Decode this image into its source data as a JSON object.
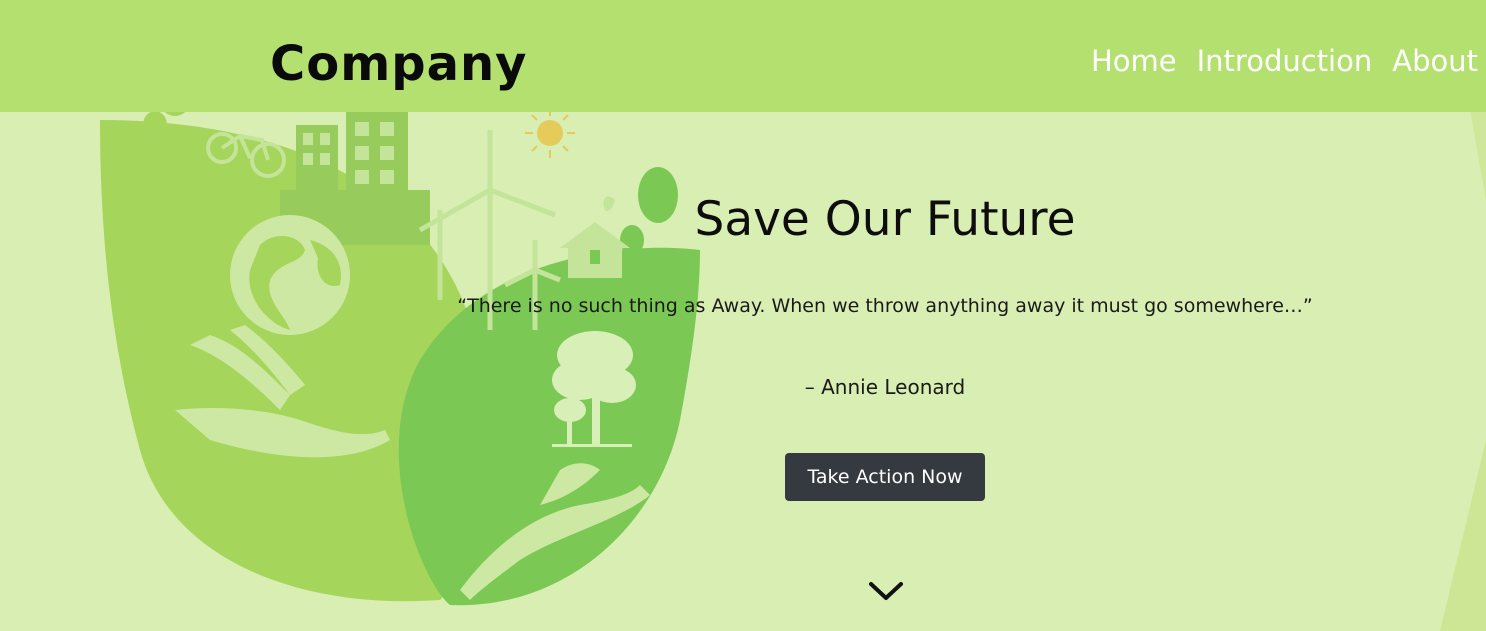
{
  "brand": {
    "name": "Company"
  },
  "nav": {
    "items": [
      "Home",
      "Introduction",
      "About"
    ]
  },
  "hero": {
    "title": "Save Our Future",
    "quote": "“There is no such thing as Away. When we throw anything away it must go somewhere…”",
    "author": "– Annie Leonard",
    "cta_label": "Take Action Now"
  },
  "colors": {
    "navbar": "#b3e06f",
    "background": "#d9eeb3",
    "button": "#343a40"
  },
  "icons": [
    "chevron-down-icon"
  ]
}
